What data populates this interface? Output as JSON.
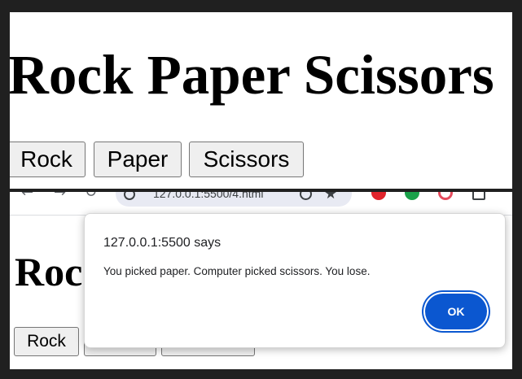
{
  "top_page": {
    "title": "Rock Paper Scissors",
    "buttons": {
      "rock": "Rock",
      "paper": "Paper",
      "scissors": "Scissors"
    }
  },
  "browser": {
    "url": "127.0.0.1:5500/4.html",
    "icons": [
      "back-arrow-icon",
      "forward-arrow-icon",
      "reload-icon",
      "site-info-icon",
      "search-icon",
      "bookmark-star-icon",
      "extension-icon",
      "profile-icon"
    ]
  },
  "bottom_page": {
    "title": "Roc",
    "buttons": {
      "rock": "Rock"
    }
  },
  "dialog": {
    "origin": "127.0.0.1:5500 says",
    "message": "You picked paper. Computer picked scissors. You lose.",
    "ok_label": "OK",
    "accent_color": "#0b57d0"
  }
}
